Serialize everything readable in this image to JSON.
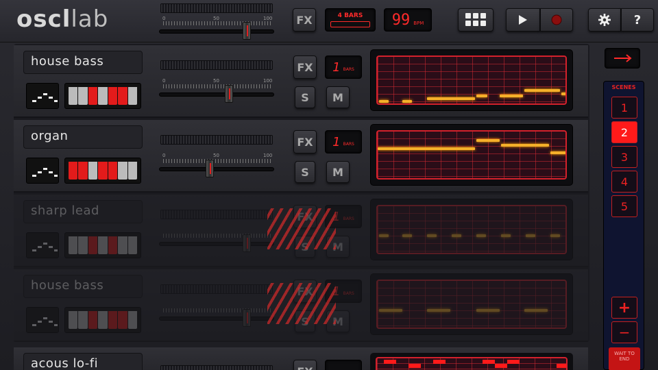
{
  "app": {
    "logo_bold": "oscl",
    "logo_thin": "lab"
  },
  "master": {
    "tick_min": "0",
    "tick_mid": "50",
    "tick_max": "100",
    "level": 0.68,
    "fx_label": "FX",
    "bars_label": "4 BARS",
    "bpm_value": "99",
    "bpm_unit": "BPM"
  },
  "toolbar": {
    "grid_icon": "grid-icon",
    "play_icon": "play-icon",
    "record_icon": "record-icon",
    "settings_icon": "gear-icon",
    "help_label": "?"
  },
  "tracks": [
    {
      "name": "house bass",
      "fx": "FX",
      "bars_num": "1",
      "bars_unit": "BARS",
      "solo": "S",
      "mute": "M",
      "level": 0.59,
      "dimmed": false
    },
    {
      "name": "organ",
      "fx": "FX",
      "bars_num": "1",
      "bars_unit": "BARS",
      "solo": "S",
      "mute": "M",
      "level": 0.42,
      "dimmed": false
    },
    {
      "name": "sharp lead",
      "fx": "FX",
      "bars_num": "1",
      "bars_unit": "BARS",
      "solo": "S",
      "mute": "M",
      "level": 0.72,
      "dimmed": true
    },
    {
      "name": "house bass",
      "fx": "FX",
      "bars_num": "1",
      "bars_unit": "BARS",
      "solo": "S",
      "mute": "M",
      "level": 0.72,
      "dimmed": true
    },
    {
      "name": "acous lo-fi",
      "fx": "FX",
      "dimmed": false
    }
  ],
  "slider_ticks": {
    "min": "0",
    "mid": "50",
    "max": "100"
  },
  "scenes": {
    "title": "SCENES",
    "items": [
      "1",
      "2",
      "3",
      "4",
      "5"
    ],
    "active": "2",
    "add_label": "+",
    "remove_label": "−",
    "wait_label": "WAIT TO END"
  },
  "colors": {
    "accent": "#ff1a1a",
    "note": "#f5b02a",
    "sidebar": "#0f1430"
  }
}
